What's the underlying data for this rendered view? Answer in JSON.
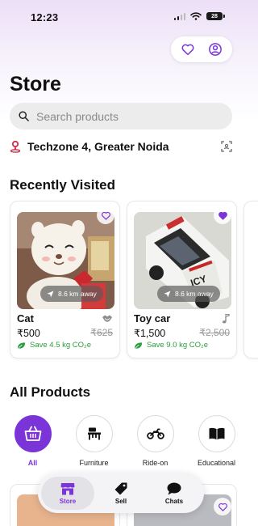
{
  "status": {
    "time": "12:23",
    "battery": "28"
  },
  "header": {
    "title": "Store"
  },
  "search": {
    "placeholder": "Search products"
  },
  "location": {
    "text": "Techzone 4, Greater Noida"
  },
  "recent": {
    "title": "Recently Visited",
    "items": [
      {
        "name": "Cat",
        "price": "₹500",
        "old_price": "₹625",
        "distance": "8.6 km away",
        "save": "Save 4.5 kg CO₂e",
        "favorited": false,
        "category_icon": "handshake-icon"
      },
      {
        "name": "Toy car",
        "price": "₹1,500",
        "old_price": "₹2,500",
        "distance": "8.6 km away",
        "save": "Save 9.0 kg CO₂e",
        "favorited": true,
        "category_icon": "music-note-icon"
      }
    ]
  },
  "all_products": {
    "title": "All Products",
    "categories": [
      {
        "label": "All",
        "icon": "basket-icon",
        "active": true
      },
      {
        "label": "Furniture",
        "icon": "chair-desk-icon",
        "active": false
      },
      {
        "label": "Ride-on",
        "icon": "motorbike-icon",
        "active": false
      },
      {
        "label": "Educational",
        "icon": "book-icon",
        "active": false
      }
    ]
  },
  "tabbar": {
    "tabs": [
      {
        "label": "Store",
        "icon": "store-icon",
        "active": true
      },
      {
        "label": "Sell",
        "icon": "tag-icon",
        "active": false
      },
      {
        "label": "Chats",
        "icon": "chat-bubble-icon",
        "active": false
      }
    ]
  },
  "colors": {
    "accent": "#7a34d8",
    "save_green": "#2a9d3e"
  }
}
